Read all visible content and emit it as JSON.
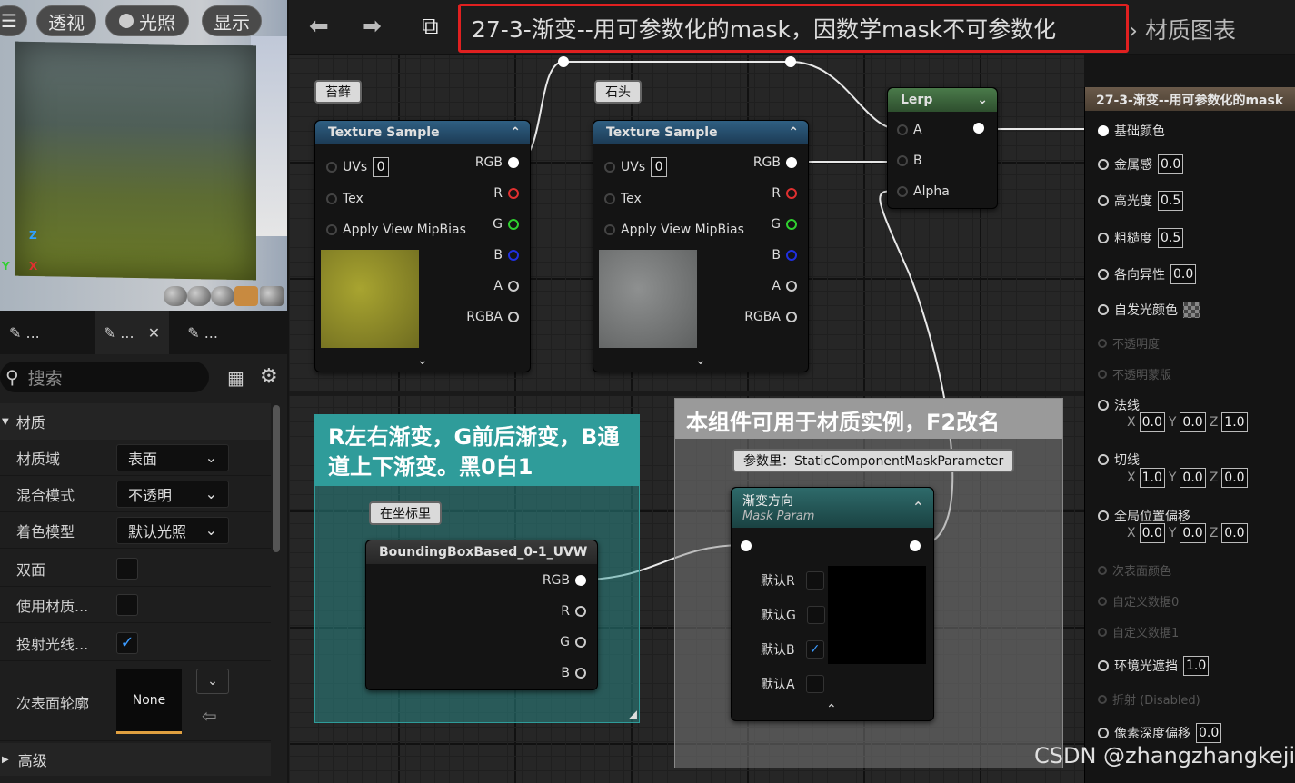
{
  "viewport": {
    "buttons": [
      {
        "label": "透视"
      },
      {
        "label": "光照"
      },
      {
        "label": "显示"
      }
    ],
    "axes": {
      "z": "Z",
      "y": "Y",
      "x": "X"
    }
  },
  "details_panel": {
    "tabs": [
      "...",
      "...",
      "..."
    ],
    "search_placeholder": "搜索",
    "section_material": "材质",
    "rows": {
      "domain_label": "材质域",
      "domain_value": "表面",
      "blend_label": "混合模式",
      "blend_value": "不透明",
      "shading_label": "着色模型",
      "shading_value": "默认光照",
      "two_sided_label": "双面",
      "use_material_label": "使用材质...",
      "cast_ray_label": "投射光线...",
      "subsurface_label": "次表面轮廓",
      "subsurface_value": "None"
    },
    "section_advanced": "高级"
  },
  "toolbar": {
    "title": "27-3-渐变--用可参数化的mask，因数学mask不可参数化",
    "breadcrumb_tail": "材质图表",
    "title_highlight_color": "#e02020"
  },
  "nodes": {
    "moss_tag": "苔藓",
    "stone_tag": "石头",
    "texture_sample_title": "Texture Sample",
    "uvs": "UVs",
    "uvs_value": "0",
    "tex": "Tex",
    "mipbias": "Apply View MipBias",
    "out_rgb": "RGB",
    "out_r": "R",
    "out_g": "G",
    "out_b": "B",
    "out_a": "A",
    "out_rgba": "RGBA",
    "lerp_title": "Lerp",
    "lerp_a": "A",
    "lerp_b": "B",
    "lerp_alpha": "Alpha",
    "comment1": "R左右渐变，G前后渐变，B通道上下渐变。黑0白1",
    "comment1_color": "#2f9c9a",
    "coord_tag": "在坐标里",
    "bbox_title": "BoundingBoxBased_0-1_UVW",
    "comment2": "本组件可用于材质实例，F2改名",
    "param_tag": "参数里：StaticComponentMaskParameter",
    "mask_title": "渐变方向",
    "mask_subtitle": "Mask Param",
    "mask_r": "默认R",
    "mask_g": "默认G",
    "mask_b": "默认B",
    "mask_a": "默认A"
  },
  "result_node": {
    "title": "27-3-渐变--用可参数化的mask",
    "base_color": "基础颜色",
    "metallic": "金属感",
    "metallic_value": "0.0",
    "specular": "高光度",
    "specular_value": "0.5",
    "roughness": "粗糙度",
    "roughness_value": "0.5",
    "anisotropy": "各向异性",
    "anisotropy_value": "0.0",
    "emissive": "自发光颜色",
    "opacity": "不透明度",
    "opacity_mask": "不透明蒙版",
    "normal": "法线",
    "normal_x": "0.0",
    "normal_y": "0.0",
    "normal_z": "1.0",
    "tangent": "切线",
    "tangent_x": "1.0",
    "tangent_y": "0.0",
    "tangent_z": "0.0",
    "wpo": "全局位置偏移",
    "wpo_x": "0.0",
    "wpo_y": "0.0",
    "wpo_z": "0.0",
    "subsurface_color": "次表面颜色",
    "custom0": "自定义数据0",
    "custom1": "自定义数据1",
    "ao": "环境光遮挡",
    "ao_value": "1.0",
    "refraction": "折射 (Disabled)",
    "pixel_depth": "像素深度偏移",
    "pixel_depth_value": "0.0",
    "axis_x": "X",
    "axis_y": "Y",
    "axis_z": "Z"
  },
  "watermark": "CSDN @zhangzhangkeji"
}
